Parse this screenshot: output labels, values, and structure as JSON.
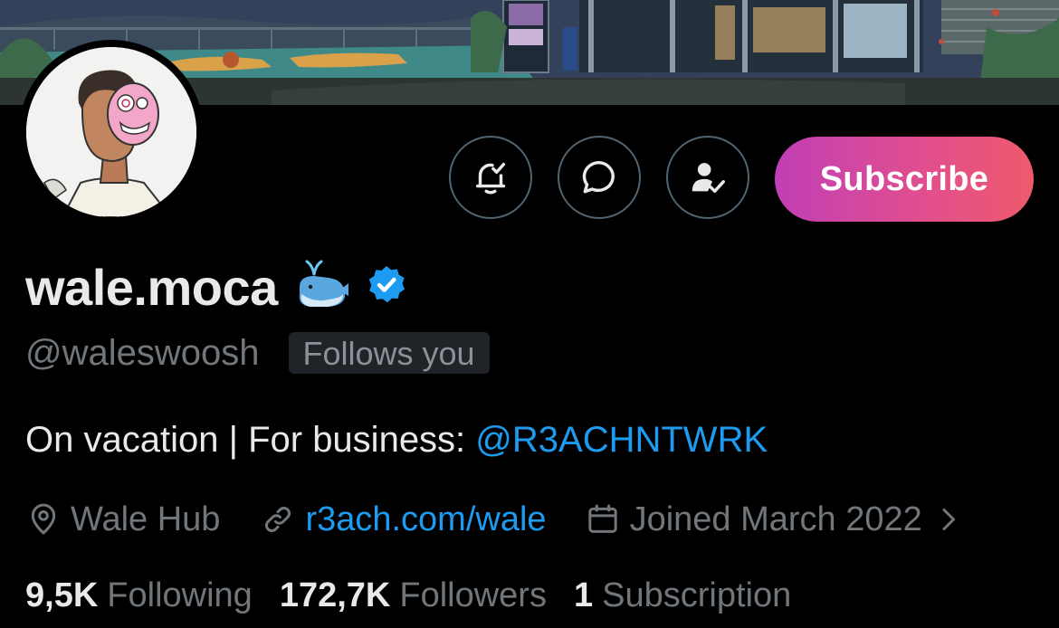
{
  "profile": {
    "display_name": "wale.moca",
    "handle": "@waleswoosh",
    "follows_you": "Follows you",
    "bio_text": "On vacation | For business: ",
    "bio_link": "@R3ACHNTWRK",
    "location": "Wale Hub",
    "website": "r3ach.com/wale",
    "joined": "Joined March 2022"
  },
  "actions": {
    "subscribe_label": "Subscribe"
  },
  "stats": {
    "following_count": "9,5K",
    "following_label": "Following",
    "followers_count": "172,7K",
    "followers_label": "Followers",
    "subscriptions_count": "1",
    "subscriptions_label": "Subscription"
  },
  "icons": {
    "notify": "bell-check-icon",
    "message": "chat-bubble-icon",
    "follow": "person-check-icon",
    "whale": "whale-emoji-icon",
    "verified": "verified-badge-icon",
    "location": "location-pin-icon",
    "website": "link-icon",
    "joined": "calendar-icon",
    "chevron": "chevron-right-icon"
  },
  "colors": {
    "background": "#000000",
    "text_primary": "#e7e9ea",
    "text_secondary": "#71767b",
    "link": "#1d9bf0",
    "verified": "#1d9bf0",
    "subscribe_gradient_start": "#c13fb6",
    "subscribe_gradient_end": "#ee5a6a",
    "button_border": "#536471"
  }
}
